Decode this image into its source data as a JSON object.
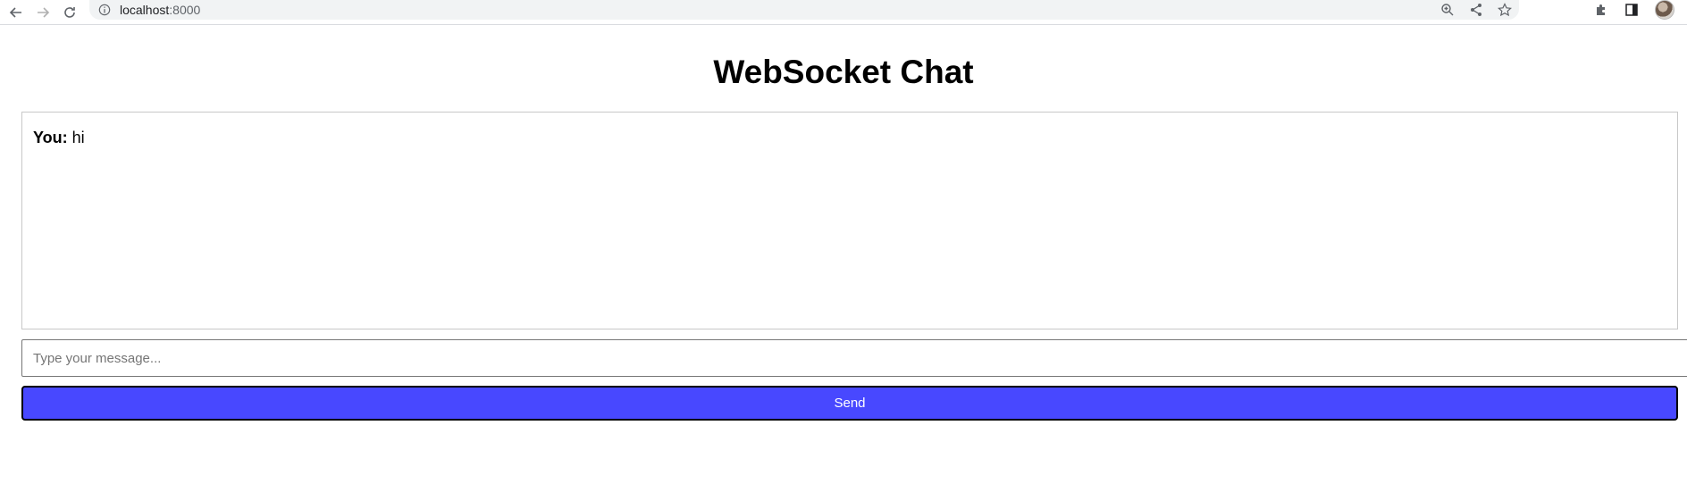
{
  "browser": {
    "url_host": "localhost",
    "url_port": ":8000"
  },
  "page": {
    "title": "WebSocket Chat"
  },
  "chat": {
    "messages": [
      {
        "sender": "You:",
        "text": " hi"
      }
    ]
  },
  "composer": {
    "placeholder": "Type your message...",
    "value": "",
    "send_label": "Send"
  },
  "colors": {
    "send_button": "#4848ff",
    "send_text": "#ffffff"
  }
}
